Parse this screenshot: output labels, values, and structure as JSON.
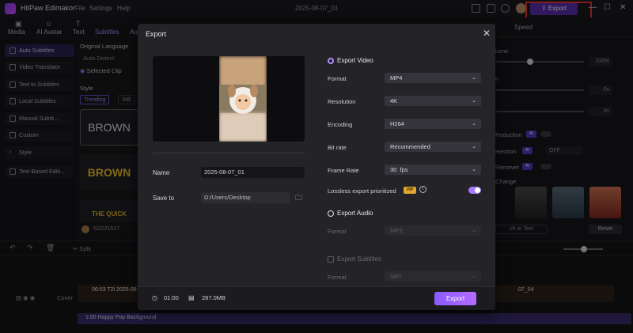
{
  "app": {
    "title": "HitPaw Edimakor",
    "menu": [
      "File",
      "Settings",
      "Help"
    ],
    "project_date": "2025-08-07_01",
    "export_button": "Export"
  },
  "toolbar": {
    "items": [
      "Media",
      "AI Avatar",
      "Text",
      "Subtitles",
      "Au"
    ]
  },
  "left_panel": {
    "items": [
      "Auto Subtitles",
      "Video Translator",
      "Text to Subtitles",
      "Local Subtitles",
      "Manual Subtit...",
      "Custom",
      "Style",
      "Text-Based Editi..."
    ],
    "selected": "Auto Subtitles"
  },
  "mid_panel": {
    "original_language_label": "Original Language",
    "auto_detect": "Auto Detect",
    "selected_clip": "Selected Clip",
    "style_label": "Style",
    "style_tabs": [
      "Trending",
      "Still"
    ],
    "style_card_1": "BROWN",
    "style_card_2": "BROWN",
    "style_card_3": "THE QUICK",
    "progress_text": "5/2221517"
  },
  "right_panel": {
    "tab": "Speed",
    "volume_label": "lume",
    "volume_value": "100%",
    "row2_label": "n",
    "row2_value": "0s",
    "row3_value": "0s",
    "noise_reduction": "Reduction",
    "detection": "etection",
    "detection_value": "OFF",
    "remover": "Remover",
    "ai_badge": "AI",
    "change_label": "Change",
    "switch_text": "ch to Text",
    "reset": "Reset"
  },
  "timeline": {
    "split_label": "Split",
    "cover_label": "Cover",
    "video_clip_label": "00:03 T2l 2025-08-07_01",
    "video_clip_label_right": "07_04",
    "audio_label": "1:00 Happy Pop Background"
  },
  "dialog": {
    "title": "Export",
    "name_label": "Name",
    "name_value": "2025-08-07_01",
    "save_to_label": "Save to",
    "save_to_value": "D:/Users/Desktop",
    "export_video_label": "Export Video",
    "format_label": "Format",
    "format_value": "MP4",
    "resolution_label": "Resolution",
    "resolution_value": "4K",
    "encoding_label": "Encoding",
    "encoding_value": "H264",
    "bitrate_label": "Bit rate",
    "bitrate_value": "Recommended",
    "framerate_label": "Frame Rate",
    "framerate_value": "30  fps",
    "lossless_label": "Lossless export prioritized",
    "vip_badge": "VIP",
    "lossless_enabled": true,
    "export_audio_label": "Export Audio",
    "audio_format_label": "Format",
    "audio_format_value": "MP3",
    "export_subtitles_label": "Export Subtitles",
    "subtitles_format_label": "Format",
    "subtitles_format_value": "SRT",
    "duration": "01:00",
    "file_size": "287.0MB",
    "export_button": "Export"
  },
  "colors": {
    "accent": "#a47aff",
    "highlight_box": "#e43a3a"
  }
}
